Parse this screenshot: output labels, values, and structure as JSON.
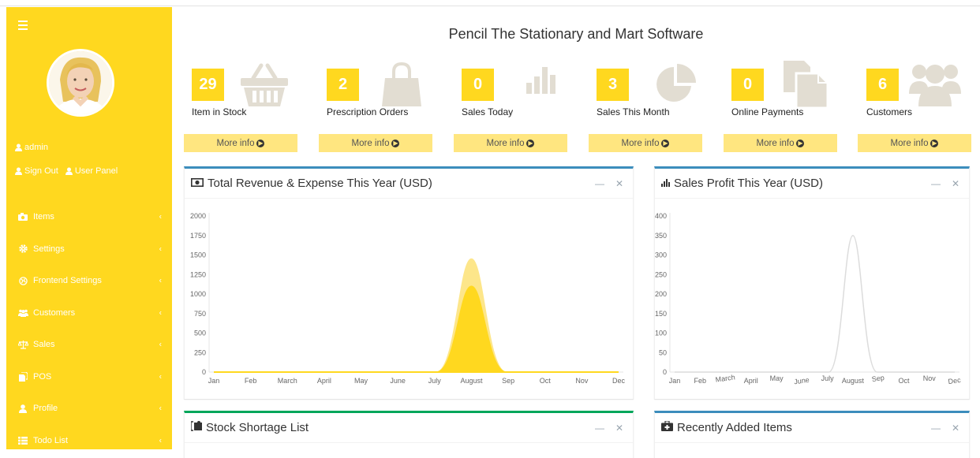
{
  "sidebar": {
    "user": {
      "name": "admin"
    },
    "links": {
      "sign_out": "Sign Out",
      "user_panel": "User Panel"
    },
    "items": [
      {
        "label": "Items",
        "icon": "camera-icon"
      },
      {
        "label": "Settings",
        "icon": "gear-icon"
      },
      {
        "label": "Frontend Settings",
        "icon": "globe-icon"
      },
      {
        "label": "Customers",
        "icon": "users-icon"
      },
      {
        "label": "Sales",
        "icon": "balance-scale-icon"
      },
      {
        "label": "POS",
        "icon": "copy-icon"
      },
      {
        "label": "Profile",
        "icon": "user-icon"
      },
      {
        "label": "Todo List",
        "icon": "list-icon"
      }
    ]
  },
  "header": {
    "title": "Pencil The Stationary and Mart Software"
  },
  "stats": [
    {
      "value": "29",
      "label": "Item in Stock",
      "icon": "basket-icon",
      "more": "More info"
    },
    {
      "value": "2",
      "label": "Prescription Orders",
      "icon": "shopping-bag-icon",
      "more": "More info"
    },
    {
      "value": "0",
      "label": "Sales Today",
      "icon": "bar-chart-icon",
      "more": "More info"
    },
    {
      "value": "3",
      "label": "Sales This Month",
      "icon": "pie-chart-icon",
      "more": "More info"
    },
    {
      "value": "0",
      "label": "Online Payments",
      "icon": "files-icon",
      "more": "More info"
    },
    {
      "value": "6",
      "label": "Customers",
      "icon": "users-icon",
      "more": "More info"
    }
  ],
  "panels": {
    "revenue": {
      "title": "Total Revenue & Expense This Year (USD)",
      "icon": "money-icon"
    },
    "profit": {
      "title": "Sales Profit This Year (USD)",
      "icon": "bar-chart-icon"
    },
    "shortage": {
      "title": "Stock Shortage List",
      "icon": "puzzle-icon"
    },
    "recent": {
      "title": "Recently Added Items",
      "icon": "medkit-icon"
    }
  },
  "colors": {
    "accent": "#ffd81f",
    "more_bg": "#ffe680",
    "box_blue": "#3c8dbc",
    "box_green": "#00a65a",
    "icon_grey": "#e2ddd2"
  },
  "chart_data": [
    {
      "type": "area",
      "title": "Total Revenue & Expense This Year (USD)",
      "categories": [
        "Jan",
        "Feb",
        "March",
        "April",
        "May",
        "June",
        "July",
        "August",
        "Sep",
        "Oct",
        "Nov",
        "Dec"
      ],
      "series": [
        {
          "values": [
            0,
            0,
            0,
            0,
            0,
            0,
            0,
            1450,
            0,
            0,
            0,
            0
          ],
          "color": "#fde68a"
        },
        {
          "values": [
            0,
            0,
            0,
            0,
            0,
            0,
            0,
            1100,
            0,
            0,
            0,
            0
          ],
          "color": "#ffd81f"
        }
      ],
      "yticks": [
        0,
        250,
        500,
        750,
        1000,
        1250,
        1500,
        1750,
        2000
      ],
      "ylim": [
        0,
        2000
      ],
      "grid": false
    },
    {
      "type": "line",
      "title": "Sales Profit This Year (USD)",
      "categories": [
        "Jan",
        "Feb",
        "March",
        "April",
        "May",
        "June",
        "July",
        "August",
        "Sep",
        "Oct",
        "Nov",
        "Dec"
      ],
      "series": [
        {
          "values": [
            0,
            0,
            0,
            0,
            0,
            0,
            0,
            350,
            0,
            0,
            0,
            0
          ],
          "color": "#dcdcdc"
        }
      ],
      "yticks": [
        0,
        50,
        100,
        150,
        200,
        250,
        300,
        350,
        400
      ],
      "ylim": [
        0,
        400
      ],
      "grid": false
    }
  ]
}
